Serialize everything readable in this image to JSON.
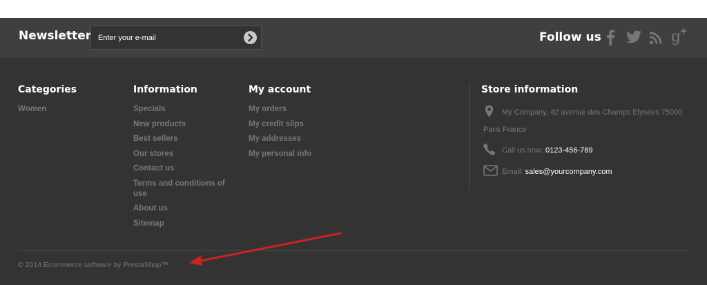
{
  "newsletter": {
    "title": "Newsletter",
    "input_placeholder": "Enter your e-mail"
  },
  "social": {
    "title": "Follow us",
    "icons": [
      "facebook-icon",
      "twitter-icon",
      "rss-icon",
      "google-plus-icon"
    ]
  },
  "columns": {
    "categories": {
      "title": "Categories",
      "items": [
        "Women"
      ]
    },
    "information": {
      "title": "Information",
      "items": [
        "Specials",
        "New products",
        "Best sellers",
        "Our stores",
        "Contact us",
        "Terms and conditions of use",
        "About us",
        "Sitemap"
      ]
    },
    "account": {
      "title": "My account",
      "items": [
        "My orders",
        "My credit slips",
        "My addresses",
        "My personal info"
      ]
    }
  },
  "store": {
    "title": "Store information",
    "address_line1": "My Company, 42 avenue des Champs Elysées 75000",
    "address_line2": "Paris France",
    "phone_label": "Call us now: ",
    "phone": "0123-456-789",
    "email_label": "Email: ",
    "email": "sales@yourcompany.com"
  },
  "copyright": "© 2014 Ecommerce software by PrestaShop™",
  "colors": {
    "bar_bg": "#3f3f3f",
    "footer_bg": "#333333",
    "link_text": "#777777",
    "heading_text": "#ffffff",
    "annotation_arrow": "#cc2222"
  }
}
